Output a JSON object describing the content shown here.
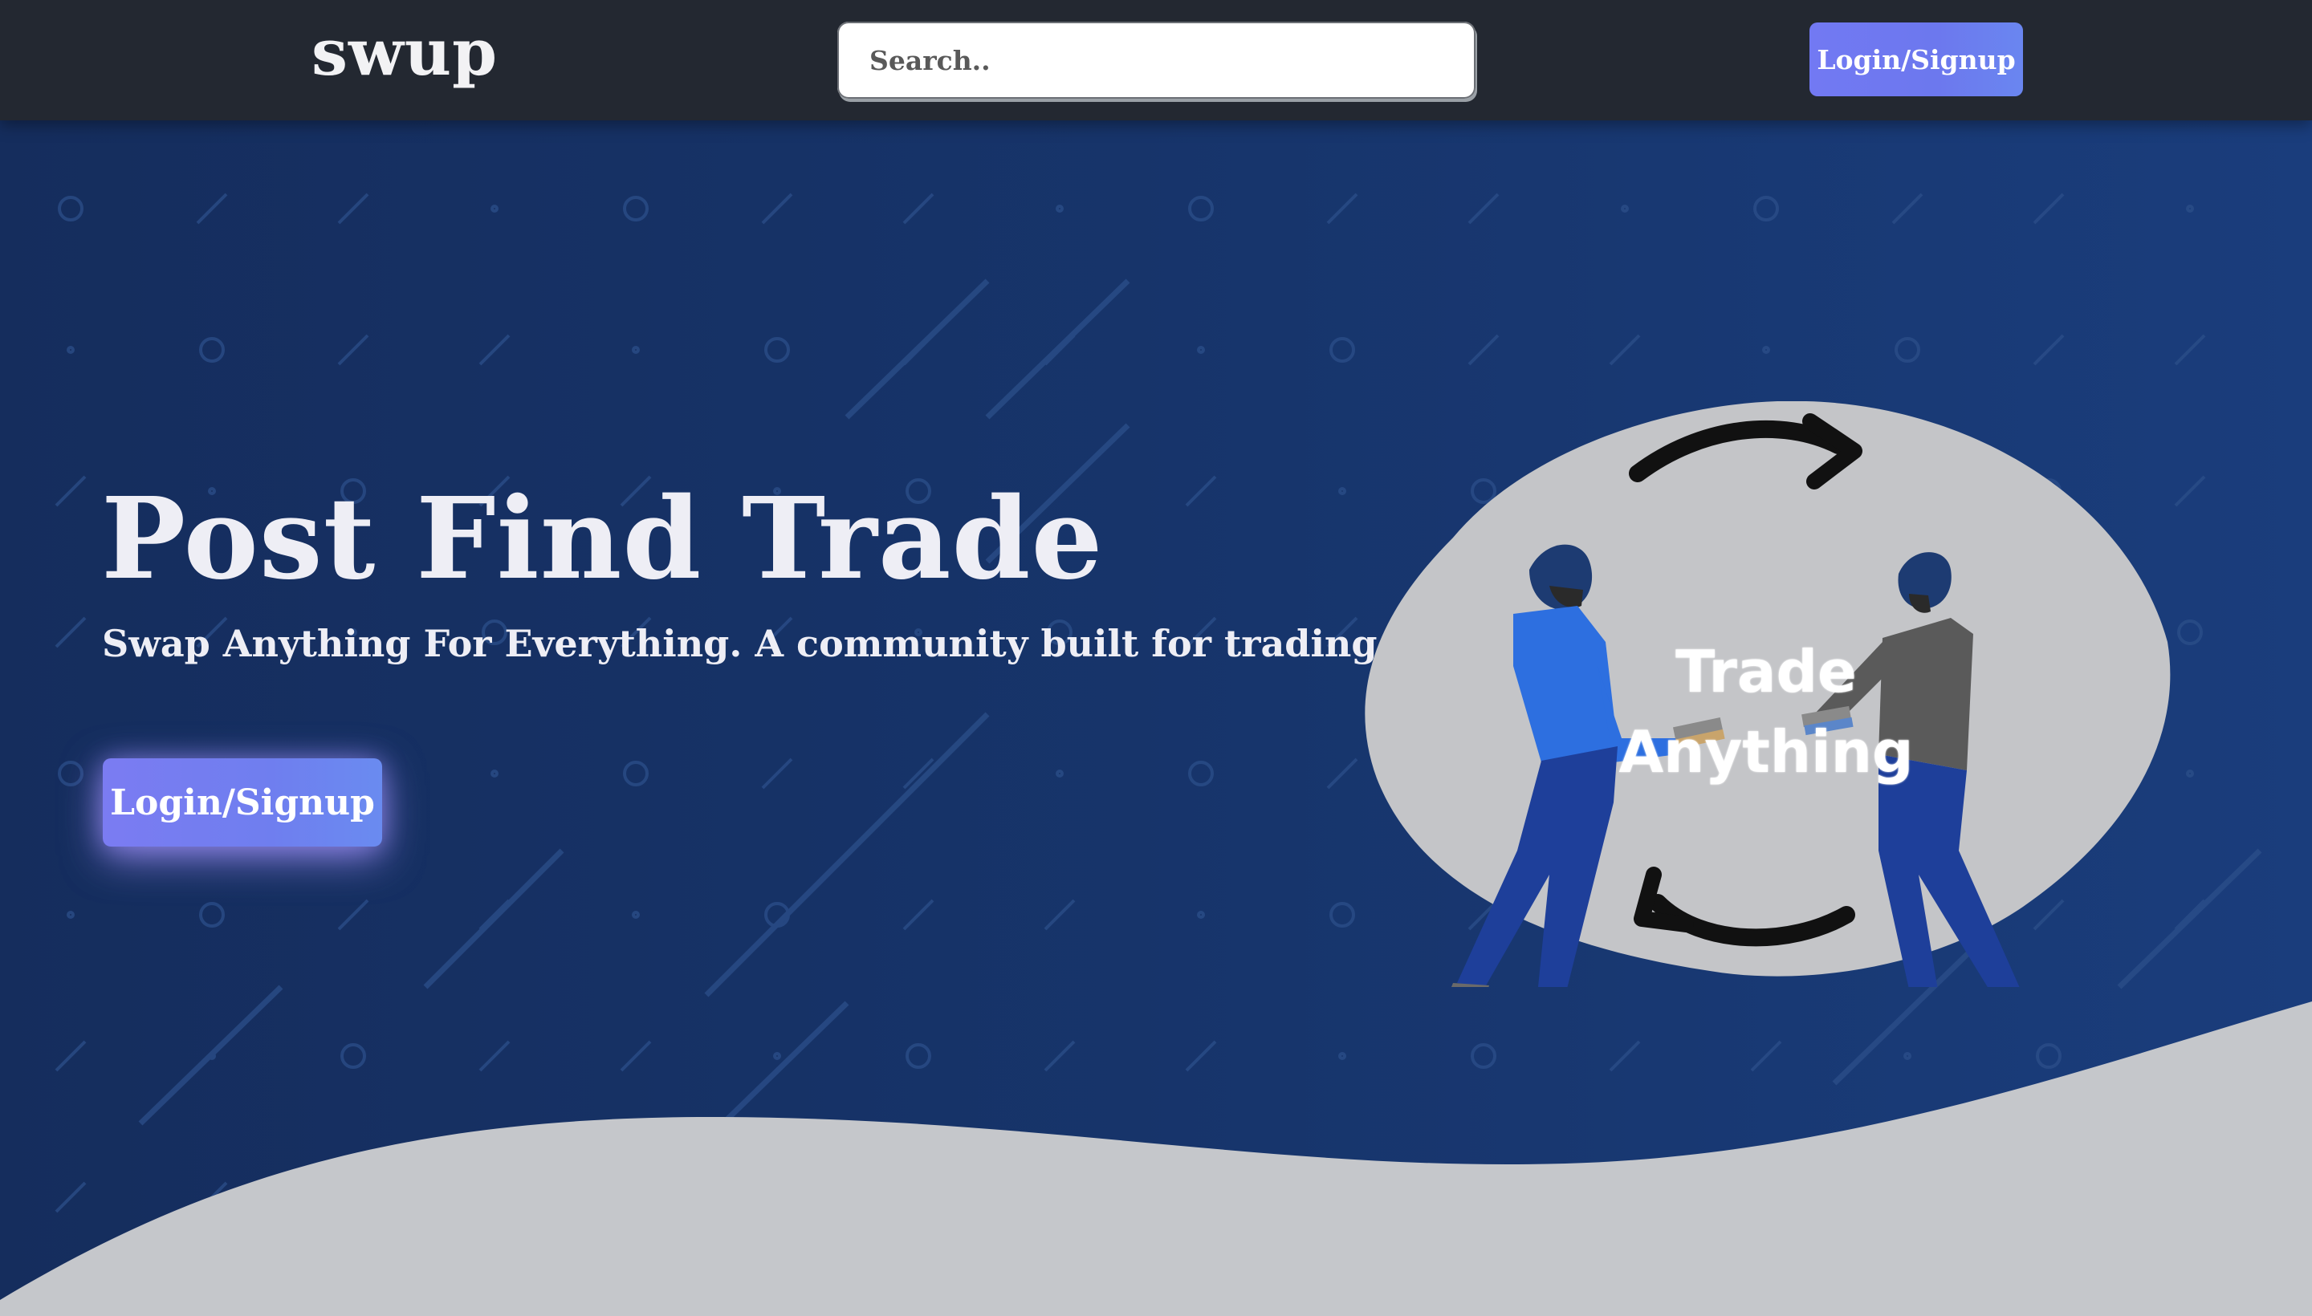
{
  "navbar": {
    "brand": "swup",
    "search_placeholder": "Search..",
    "login_label": "Login/Signup"
  },
  "hero": {
    "title": "Post Find Trade",
    "subtitle": "Swap Anything For Everything. A community built for trading.",
    "login_label": "Login/Signup",
    "illustration_text_line1": "Trade",
    "illustration_text_line2": "Anything"
  },
  "colors": {
    "navbar_bg": "#232831",
    "hero_bg": "#17356c",
    "wave": "#c5c7cb",
    "button_gradient_start": "#7279f3",
    "button_gradient_end": "#6a86f0",
    "illustration_circle": "#c4c5c8"
  },
  "icons": [
    "search-icon",
    "swap-arrow-icon"
  ]
}
